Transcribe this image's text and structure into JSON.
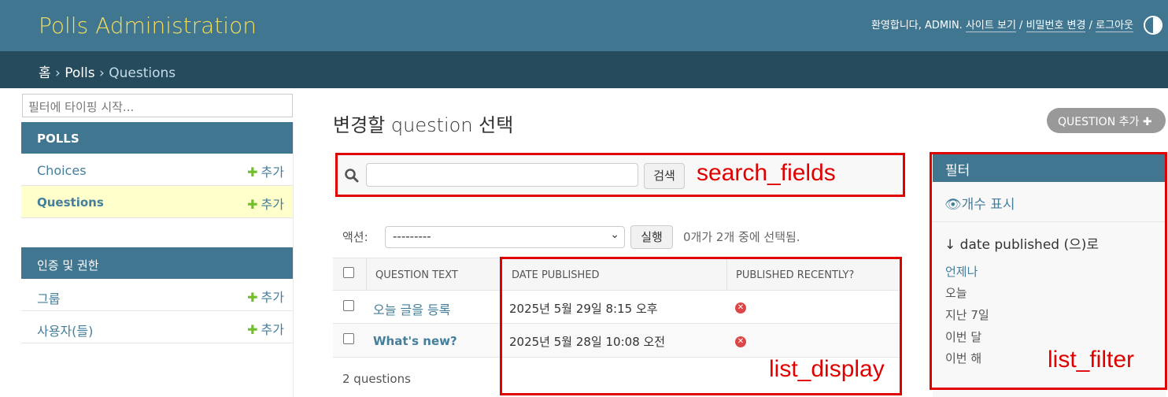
{
  "header": {
    "brand": "Polls Administration",
    "welcome": "환영합니다, ADMIN.",
    "view_site": "사이트 보기",
    "change_password": "비밀번호 변경",
    "logout": "로그아웃",
    "separator": "/",
    "theme_icon": "half-circle-icon"
  },
  "breadcrumb": {
    "home": "홈",
    "app": "Polls",
    "current": "Questions",
    "separator": "›"
  },
  "sidebar": {
    "filter_placeholder": "필터에 타이핑 시작...",
    "polls_header": "POLLS",
    "auth_header": "인증 및 권한",
    "add_label": "추가",
    "items": [
      {
        "label": "Choices"
      },
      {
        "label": "Questions"
      },
      {
        "label": "그룹"
      },
      {
        "label": "사용자(들)"
      }
    ]
  },
  "main": {
    "title": "변경할 question 선택",
    "add_button": "QUESTION 추가",
    "search_button": "검색",
    "search_value": "",
    "action_label": "액션:",
    "action_selected": "---------",
    "go_button": "실행",
    "action_counter": "0개가 2개 중에 선택됨.",
    "columns": [
      "QUESTION TEXT",
      "DATE PUBLISHED",
      "PUBLISHED RECENTLY?"
    ],
    "rows": [
      {
        "question": "오늘 글을 등록",
        "date": "2025년 5월 29일 8:15 오후",
        "recent": "no-icon"
      },
      {
        "question": "What's new?",
        "date": "2025년 5월 28일 10:08 오전",
        "recent": "no-icon"
      }
    ],
    "paginator": "2 questions"
  },
  "filter": {
    "title": "필터",
    "show_counts": "개수 표시",
    "by_label": "↓ date published (으)로",
    "options": [
      "언제나",
      "오늘",
      "지난 7일",
      "이번 달",
      "이번 해"
    ]
  },
  "annotations": {
    "search": "search_fields",
    "display": "list_display",
    "filter": "list_filter"
  },
  "colors": {
    "header": "#417690",
    "breadcrumb": "#264b5d",
    "brand": "#f5dd5d",
    "link": "#447e9b",
    "annotation": "#e00000"
  }
}
